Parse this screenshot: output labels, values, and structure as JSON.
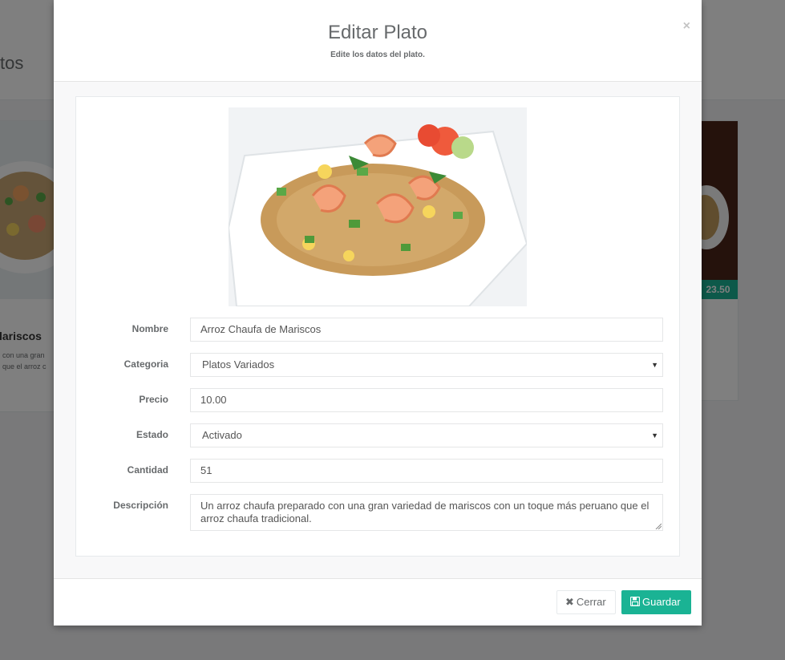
{
  "background": {
    "page_heading": "tos",
    "left_card": {
      "title": "lariscos",
      "desc_line1": "con una gran",
      "desc_line2": "que el arroz c"
    },
    "right_card": {
      "price": "23.50"
    }
  },
  "modal": {
    "title": "Editar Plato",
    "subtitle": "Edite los datos del plato.",
    "close_icon": "×",
    "image_alt": "Arroz chaufa de mariscos",
    "form": {
      "nombre": {
        "label": "Nombre",
        "value": "Arroz Chaufa de Mariscos"
      },
      "categoria": {
        "label": "Categoria",
        "value": "Platos Variados"
      },
      "precio": {
        "label": "Precio",
        "value": "10.00"
      },
      "estado": {
        "label": "Estado",
        "value": "Activado"
      },
      "cantidad": {
        "label": "Cantidad",
        "value": "51"
      },
      "descripcion": {
        "label": "Descripción",
        "value": "Un arroz chaufa preparado con una gran variedad de mariscos con un toque más peruano que el arroz chaufa tradicional."
      }
    },
    "footer": {
      "close_label": "Cerrar",
      "close_icon": "✖",
      "save_label": "Guardar",
      "save_icon": "floppy-disk-icon"
    }
  },
  "colors": {
    "accent": "#1ab394",
    "text": "#676a6c",
    "border": "#e5e6e7"
  }
}
